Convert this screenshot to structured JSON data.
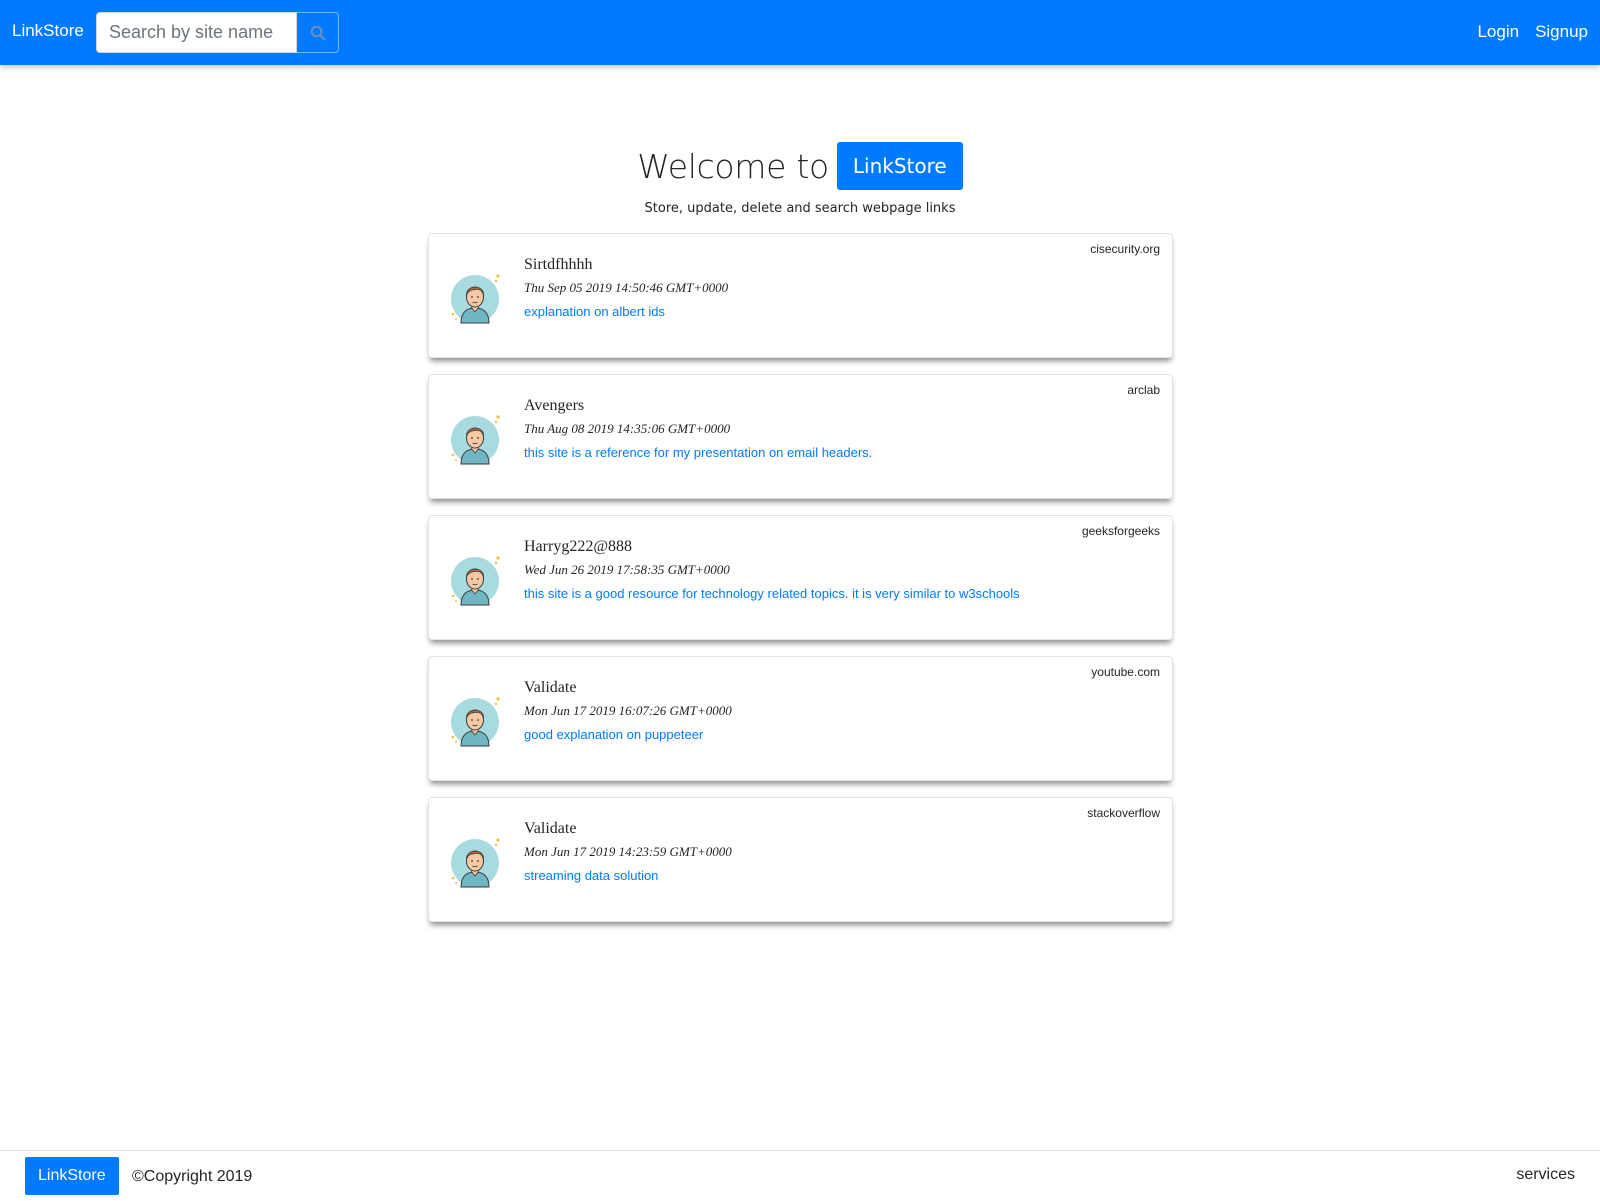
{
  "navbar": {
    "brand": "LinkStore",
    "search_placeholder": "Search by site name",
    "search_icon": "search-icon",
    "login": "Login",
    "signup": "Signup"
  },
  "hero": {
    "title": "Welcome to",
    "badge": "LinkStore",
    "subtitle": "Store, update, delete and search webpage links"
  },
  "cards": [
    {
      "site": "cisecurity.org",
      "title": "Sirtdfhhhh",
      "date": "Thu Sep 05 2019 14:50:46 GMT+0000",
      "description": "explanation on albert ids"
    },
    {
      "site": "arclab",
      "title": "Avengers",
      "date": "Thu Aug 08 2019 14:35:06 GMT+0000",
      "description": "this site is a reference for my presentation on email headers."
    },
    {
      "site": "geeksforgeeks",
      "title": "Harryg222@888",
      "date": "Wed Jun 26 2019 17:58:35 GMT+0000",
      "description": "this site is a good resource for technology related topics. it is very similar to w3schools"
    },
    {
      "site": "youtube.com",
      "title": "Validate",
      "date": "Mon Jun 17 2019 16:07:26 GMT+0000",
      "description": "good explanation on puppeteer"
    },
    {
      "site": "stackoverflow",
      "title": "Validate",
      "date": "Mon Jun 17 2019 14:23:59 GMT+0000",
      "description": "streaming data solution"
    }
  ],
  "footer": {
    "brand": "LinkStore",
    "copyright": "©Copyright 2019",
    "services": "services"
  },
  "colors": {
    "primary": "#007bff",
    "avatar_bg": "#a8dbe0",
    "link": "#007bff"
  }
}
